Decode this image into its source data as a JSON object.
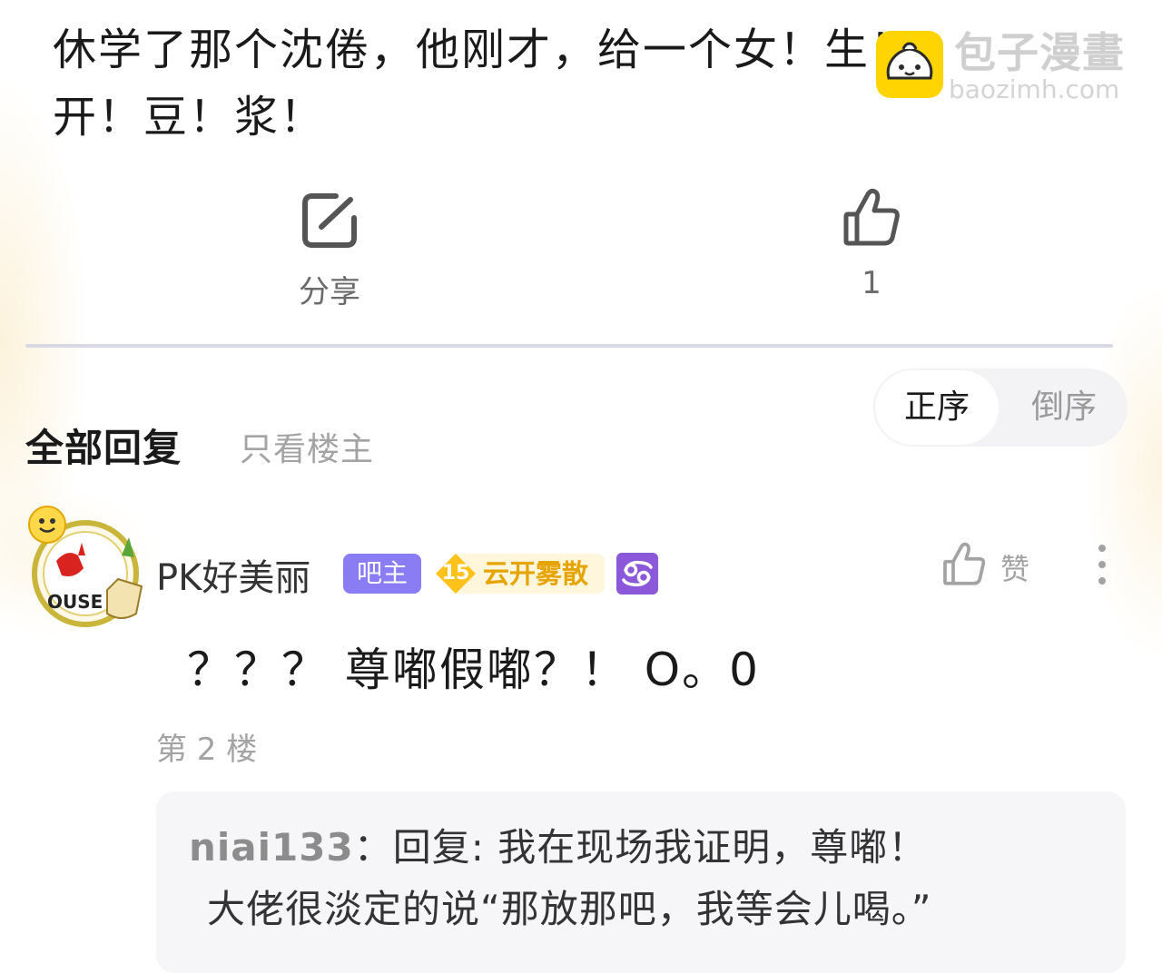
{
  "post": {
    "lines": [
      "休学了那个沈倦，他刚才，给一个女！生！",
      "开！豆！浆！"
    ]
  },
  "watermark": {
    "title": "包子漫畫",
    "subtitle": "baozimh.com",
    "logo_color": "#ffd400"
  },
  "actions": {
    "share_label": "分享",
    "like_count": "1"
  },
  "replies_header": {
    "all_label": "全部回复",
    "owner_only_label": "只看楼主",
    "sort_asc_label": "正序",
    "sort_desc_label": "倒序"
  },
  "reply": {
    "username": "PK好美丽",
    "owner_badge": "吧主",
    "level": "15",
    "level_title": "云开雾散",
    "zodiac_icon": "cancer-icon",
    "like_label": "赞",
    "content": "？？？ 尊嘟假嘟？！ O。0",
    "floor": "第 2 楼",
    "subreply": {
      "user": "niai133",
      "colon": "：",
      "line1": "回复: 我在现场我证明，尊嘟！",
      "line2": "大佬很淡定的说“那放那吧，我等会儿喝。”"
    }
  },
  "colors": {
    "owner_badge": "#8a7cf2",
    "level_badge": "#ffc21a",
    "zodiac_badge": "#8a58d8",
    "divider": "#d9d9e6"
  }
}
